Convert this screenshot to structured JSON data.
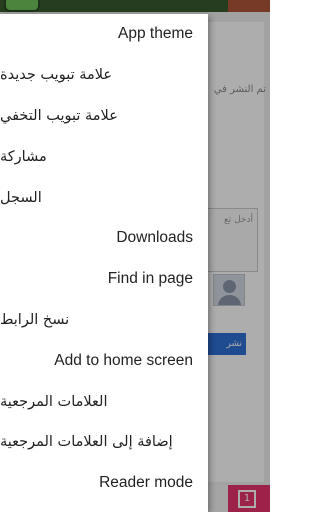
{
  "background_page": {
    "date_text": "تم النشر في",
    "comment_placeholder": "أدخل تع",
    "post_button_label": "نشر",
    "tab_count": "1"
  },
  "menu": {
    "items": [
      {
        "label": "App theme"
      },
      {
        "label": "علامة تبويب جديدة"
      },
      {
        "label": "علامة تبويب التخفي"
      },
      {
        "label": "مشاركة"
      },
      {
        "label": "السجل"
      },
      {
        "label": "Downloads"
      },
      {
        "label": "Find in page"
      },
      {
        "label": "نسخ الرابط"
      },
      {
        "label": "Add to home screen"
      },
      {
        "label": "العلامات المرجعية"
      },
      {
        "label": "إضافة إلى العلامات المرجعية"
      },
      {
        "label": "Reader mode"
      }
    ]
  },
  "colors": {
    "accent_post_button": "#2f6fd6",
    "tabs_button": "#e8336e"
  }
}
